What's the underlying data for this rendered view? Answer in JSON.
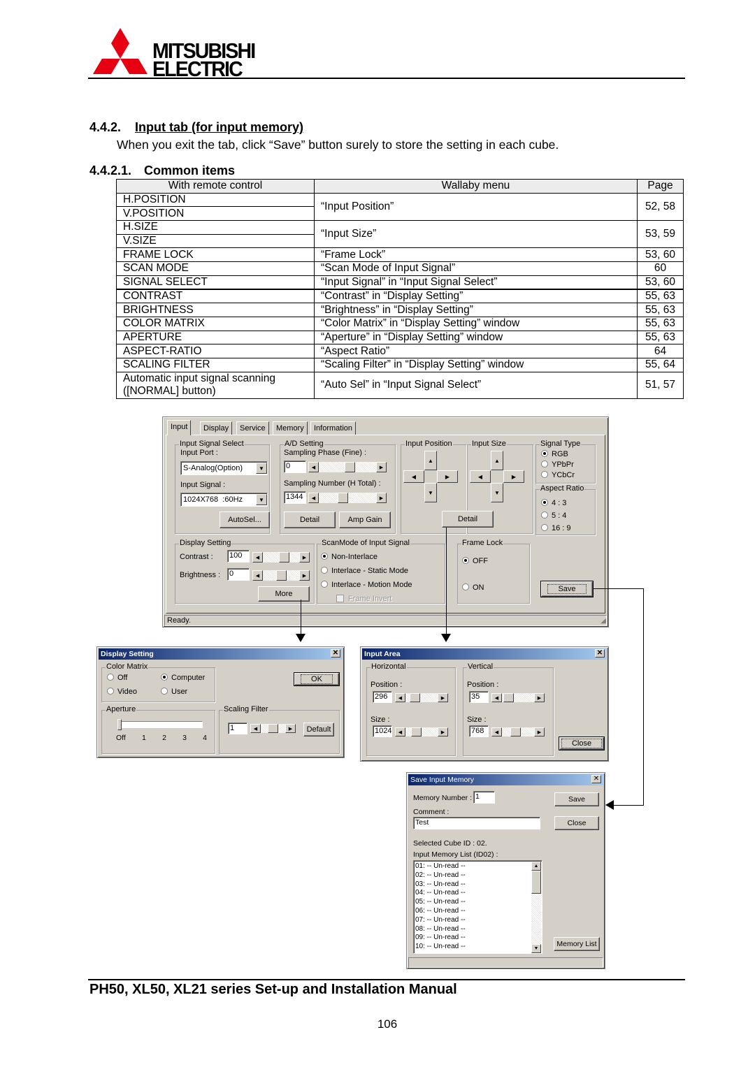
{
  "header": {
    "brand_line1": "MITSUBISHI",
    "brand_line2": "ELECTRIC",
    "logo_color": "#e60012"
  },
  "section": {
    "number": "4.4.2.",
    "title": "Input tab (for input memory)",
    "intro": "When you exit the tab, click “Save” button surely to store the setting in each cube.",
    "sub_number": "4.4.2.1.",
    "sub_title": "Common items"
  },
  "table": {
    "headers": [
      "With remote control",
      "Wallaby menu",
      "Page"
    ],
    "rows": [
      {
        "remote": [
          "H.POSITION",
          "V.POSITION"
        ],
        "menu": "“Input Position”",
        "page": "52, 58"
      },
      {
        "remote": [
          "H.SIZE",
          "V.SIZE"
        ],
        "menu": "“Input Size”",
        "page": "53, 59"
      },
      {
        "remote": [
          "FRAME LOCK"
        ],
        "menu": "“Frame Lock”",
        "page": "53, 60"
      },
      {
        "remote": [
          "SCAN MODE"
        ],
        "menu": "“Scan Mode of Input Signal”",
        "page": "60"
      },
      {
        "remote": [
          "SIGNAL SELECT"
        ],
        "menu": "“Input Signal” in “Input Signal Select”",
        "page": "53, 60"
      },
      {
        "remote": [
          "CONTRAST"
        ],
        "menu": "“Contrast” in “Display Setting”",
        "page": "55, 63"
      },
      {
        "remote": [
          "BRIGHTNESS"
        ],
        "menu": "“Brightness” in “Display Setting”",
        "page": "55, 63"
      },
      {
        "remote": [
          "COLOR MATRIX"
        ],
        "menu": "“Color Matrix” in “Display Setting” window",
        "page": "55, 63"
      },
      {
        "remote": [
          "APERTURE"
        ],
        "menu": "“Aperture” in “Display Setting” window",
        "page": "55, 63"
      },
      {
        "remote": [
          "ASPECT-RATIO"
        ],
        "menu": "“Aspect Ratio”",
        "page": "64"
      },
      {
        "remote": [
          "SCALING FILTER"
        ],
        "menu": "“Scaling Filter” in “Display Setting” window",
        "page": "55, 64"
      },
      {
        "remote": [
          "Automatic input signal scanning\n([NORMAL] button)"
        ],
        "menu": "“Auto Sel” in “Input Signal Select”",
        "page": "51, 57"
      }
    ]
  },
  "main_window": {
    "tabs": [
      "Input",
      "Display",
      "Service",
      "Memory",
      "Information"
    ],
    "active_tab": "Input",
    "input_signal_select": {
      "legend": "Input Signal Select",
      "port_label": "Input Port :",
      "port_value": "S-Analog(Option)",
      "signal_label": "Input Signal :",
      "signal_value": "1024X768  :60Hz",
      "autosel_label": "AutoSel..."
    },
    "ad_setting": {
      "legend": "A/D Setting",
      "phase_label": "Sampling Phase (Fine) :",
      "phase_value": "0",
      "phase_position": 0.55,
      "number_label": "Sampling Number (H Total) :",
      "number_value": "1344",
      "number_position": 0.4,
      "detail_label": "Detail",
      "amp_gain_label": "Amp Gain"
    },
    "input_position": {
      "legend": "Input Position"
    },
    "input_size": {
      "legend": "Input Size"
    },
    "detail_label": "Detail",
    "signal_type": {
      "legend": "Signal Type",
      "options": [
        "RGB",
        "YPbPr",
        "YCbCr"
      ],
      "selected": "RGB"
    },
    "aspect_ratio": {
      "legend": "Aspect Ratio",
      "options": [
        "4 : 3",
        "5 : 4",
        "16 : 9"
      ],
      "selected": "4 : 3"
    },
    "display_setting": {
      "legend": "Display Setting",
      "contrast_label": "Contrast :",
      "contrast_value": "100",
      "contrast_position": 0.62,
      "brightness_label": "Brightness :",
      "brightness_value": "0",
      "brightness_position": 0.5,
      "more_label": "More"
    },
    "scan_mode": {
      "legend": "ScanMode of Input Signal",
      "options": [
        "Non-Interlace",
        "Interlace - Static Mode",
        "Interlace - Motion Mode"
      ],
      "selected": "Non-Interlace",
      "frame_invert_label": "Frame Invert",
      "frame_invert_checked": false
    },
    "frame_lock": {
      "legend": "Frame Lock",
      "options": [
        "OFF",
        "ON"
      ],
      "selected": "OFF"
    },
    "save_label": "Save",
    "status": "Ready."
  },
  "display_setting_window": {
    "title": "Display Setting",
    "color_matrix": {
      "legend": "Color Matrix",
      "options": [
        "Off",
        "Computer",
        "Video",
        "User"
      ],
      "selected": "Computer"
    },
    "ok_label": "OK",
    "aperture": {
      "legend": "Aperture",
      "ticks": [
        "Off",
        "1",
        "2",
        "3",
        "4"
      ],
      "value": "Off"
    },
    "scaling_filter": {
      "legend": "Scaling Filter",
      "value": "1",
      "position": 0.5,
      "default_label": "Default"
    }
  },
  "input_area_window": {
    "title": "Input Area",
    "horizontal": {
      "legend": "Horizontal",
      "position_label": "Position :",
      "position_value": "296",
      "position_slider": 0.2,
      "size_label": "Size :",
      "size_value": "1024",
      "size_slider": 0.25
    },
    "vertical": {
      "legend": "Vertical",
      "position_label": "Position :",
      "position_value": "35",
      "position_slider": 0.05,
      "size_label": "Size :",
      "size_value": "768",
      "size_slider": 0.4
    },
    "close_label": "Close"
  },
  "save_memory_window": {
    "title": "Save Input Memory",
    "memory_number_label": "Memory Number :",
    "memory_number_value": "1",
    "comment_label": "Comment :",
    "comment_value": "Test",
    "save_label": "Save",
    "close_label": "Close",
    "cube_id": "Selected Cube ID : 02.",
    "list_label": "Input Memory List (ID02) :",
    "list_items": [
      "01: -- Un-read --",
      "02: -- Un-read --",
      "03: -- Un-read --",
      "04: -- Un-read --",
      "05: -- Un-read --",
      "06: -- Un-read --",
      "07: -- Un-read --",
      "08: -- Un-read --",
      "09: -- Un-read --",
      "10: -- Un-read --"
    ],
    "memory_list_label": "Memory List"
  },
  "footer": {
    "manual_title": "PH50, XL50, XL21 series Set-up and Installation Manual",
    "page_number": "106"
  }
}
